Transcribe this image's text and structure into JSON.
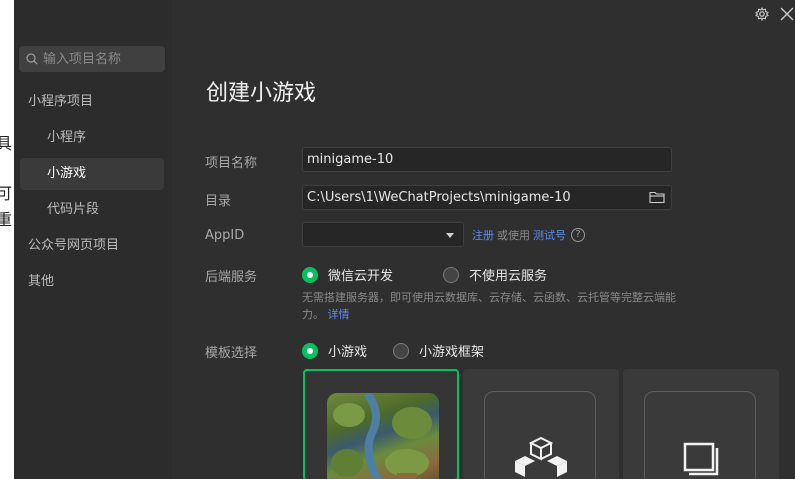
{
  "background_window": {
    "fragments": [
      "具",
      "可",
      "重"
    ]
  },
  "sidebar": {
    "search_placeholder": "输入项目名称",
    "items": [
      {
        "label": "小程序项目",
        "level": "top"
      },
      {
        "label": "小程序",
        "level": "sub"
      },
      {
        "label": "小游戏",
        "level": "sub",
        "active": true
      },
      {
        "label": "代码片段",
        "level": "sub"
      },
      {
        "label": "公众号网页项目",
        "level": "top"
      },
      {
        "label": "其他",
        "level": "top"
      }
    ]
  },
  "main": {
    "title": "创建小游戏",
    "project_name_label": "项目名称",
    "project_name_value": "minigame-10",
    "directory_label": "目录",
    "directory_value": "C:\\Users\\1\\WeChatProjects\\minigame-10",
    "appid_label": "AppID",
    "appid_value": "",
    "appid_register": "注册",
    "appid_or_use": "或使用",
    "appid_test": "测试号",
    "help_glyph": "?",
    "backend_label": "后端服务",
    "backend_options": [
      {
        "label": "微信云开发",
        "selected": true
      },
      {
        "label": "不使用云服务",
        "selected": false
      }
    ],
    "backend_desc": "无需搭建服务器，即可使用云数据库、云存储、云函数、云托管等完整云端能力。",
    "backend_desc_link": "详情",
    "template_label": "模板选择",
    "template_options": [
      {
        "label": "小游戏",
        "selected": true
      },
      {
        "label": "小游戏框架",
        "selected": false
      }
    ],
    "template_cards": [
      {
        "icon": "game-thumbnail",
        "selected": true
      },
      {
        "icon": "cubes-icon",
        "selected": false
      },
      {
        "icon": "blank-page-icon",
        "selected": false
      }
    ]
  },
  "colors": {
    "accent": "#07c160",
    "link": "#5b8def",
    "panel": "#2f2f2f",
    "sidebar": "#2c2c2c"
  }
}
